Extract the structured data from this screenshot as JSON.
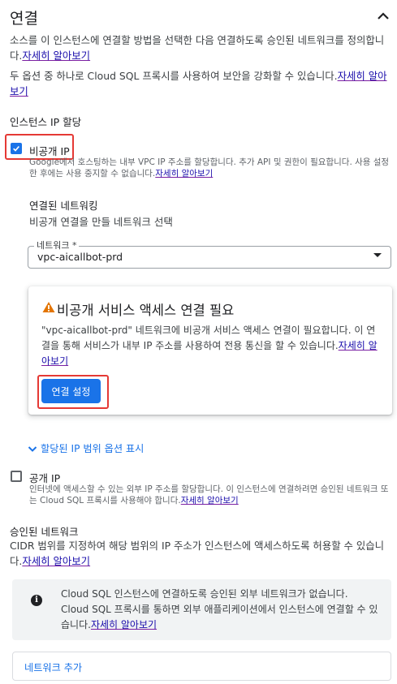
{
  "section": {
    "title": "연결",
    "intro_text": "소스를 이 인스턴스에 연결할 방법을 선택한 다음 연결하도록 승인된 네트워크를 정의합니다.",
    "intro_link": "자세히 알아보기",
    "proxy_text": "두 옵션 중 하나로 Cloud SQL 프록시를 사용하여 보안을 강화할 수 있습니다.",
    "proxy_link": "자세히 알아보기"
  },
  "ip_assignment": {
    "heading": "인스턴스 IP 할당",
    "private_ip": {
      "label": "비공개 IP",
      "checked": true,
      "description": "Google에서 호스팅하는 내부 VPC IP 주소를 할당합니다. 추가 API 및 권한이 필요합니다. 사용 설정한 후에는 사용 중지할 수 없습니다.",
      "link": "자세히 알아보기"
    },
    "associated_networking": {
      "heading": "연결된 네트워킹",
      "subheading": "비공개 연결을 만들 네트워크 선택"
    },
    "network_select": {
      "label": "네트워크 *",
      "value": "vpc-aicallbot-prd"
    },
    "service_card": {
      "title": "비공개 서비스 액세스 연결 필요",
      "body": "\"vpc-aicallbot-prd\" 네트워크에 비공개 서비스 액세스 연결이 필요합니다. 이 연결을 통해 서비스가 내부 IP 주소를 사용하여 전용 통신을 할 수 있습니다.",
      "link": "자세히 알아보기",
      "button": "연결 설정"
    },
    "expander_label": "할당된 IP 범위 옵션 표시",
    "public_ip": {
      "label": "공개 IP",
      "checked": false,
      "description": "인터넷에 액세스할 수 있는 외부 IP 주소를 할당합니다. 이 인스턴스에 연결하려면 승인된 네트워크 또는 Cloud SQL 프록시를 사용해야 합니다.",
      "link": "자세히 알아보기"
    }
  },
  "authorized_networks": {
    "heading": "승인된 네트워크",
    "description": "CIDR 범위를 지정하여 해당 범위의 IP 주소가 인스턴스에 액세스하도록 허용할 수 있습니다.",
    "link": "자세히 알아보기",
    "info": {
      "line1": "Cloud SQL 인스턴스에 연결하도록 승인된 외부 네트워크가 없습니다.",
      "line2": "Cloud SQL 프록시를 통하면 외부 애플리케이션에서 인스턴스에 연결할 수 있습니다.",
      "link": "자세히 알아보기"
    },
    "add_button": "네트워크 추가"
  },
  "colors": {
    "accent": "#1a73e8",
    "highlight": "#e53935",
    "warning": "#e37400"
  }
}
